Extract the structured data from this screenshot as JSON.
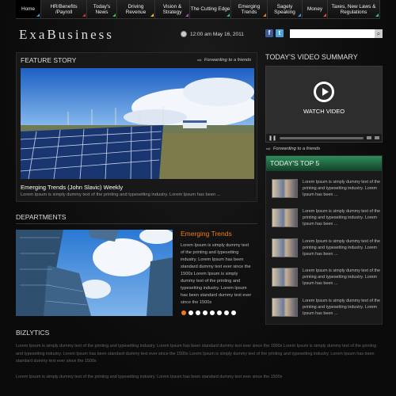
{
  "nav": [
    {
      "label": "Home",
      "color": "#2a9df4"
    },
    {
      "label": "HR/Benefits /Payroll",
      "color": "#e03030"
    },
    {
      "label": "Today's News",
      "color": "#2ecc40"
    },
    {
      "label": "Driving Revenue",
      "color": "#f1c40f"
    },
    {
      "label": "Vision & Strategy",
      "color": "#9b59b6"
    },
    {
      "label": "The Cutting Edge",
      "color": "#1abc9c"
    },
    {
      "label": "Emerging Trends",
      "color": "#e67e22"
    },
    {
      "label": "Sagely Speaking",
      "color": "#3498db"
    },
    {
      "label": "Money",
      "color": "#e74c3c"
    },
    {
      "label": "Taxes, New Laws & Regulations",
      "color": "#2ecc71"
    }
  ],
  "logo": "ExaBusiness",
  "clock": "12:00 am May 16, 2011",
  "social": {
    "facebook": "f",
    "twitter": "t"
  },
  "search": {
    "placeholder": ""
  },
  "feature": {
    "heading": "FEATURE STORY",
    "forward": "Forwarding to a friends",
    "title": "Emerging Trends (John Slavic)  Weekly",
    "desc": "Lorem Ipsum is simply dummy text of the printing and typesetting industry. Lorem Ipsum has been ..."
  },
  "video": {
    "heading": "TODAY'S VIDEO SUMMARY",
    "watch": "WATCH VIDEO",
    "forward": "Forwarding to a friends"
  },
  "top5": {
    "heading": "TODAY'S TOP 5",
    "items": [
      "Lorem Ipsum is simply dummy text of the printing and typesetting industry. Lorem Ipsum has been ...",
      "Lorem Ipsum is simply dummy text of the printing and typesetting industry. Lorem Ipsum has been ...",
      "Lorem Ipsum is simply dummy text of the printing and typesetting industry. Lorem Ipsum has been ...",
      "Lorem Ipsum is simply dummy text of the printing and typesetting industry. Lorem Ipsum has been ...",
      "Lorem Ipsum is simply dummy text of the printing and typesetting industry. Lorem Ipsum has been ..."
    ]
  },
  "departments": {
    "heading": "DEPARTMENTS",
    "title": "Emerging Trends",
    "text": "Lorem Ipsum is simply dummy text of the printing and typesetting industry. Lorem Ipsum has been standard dummy text ever since the 1500s Lorem Ipsum is simply dummy text of the printing and typesetting industry. Lorem Ipsum has been standard dummy text ever since the 1500s",
    "slides": 8,
    "active_slide": 1
  },
  "bizlytics": {
    "heading": "BIZLYTICS",
    "p1": "Lorem Ipsum is simply dummy text of the printing and typesetting industry. Lorem Ipsum has been standard dummy text ever since the 1500s Lorem Ipsum is simply dummy text of the printing and typesetting industry. Lorem Ipsum has been standard dummy text ever since the 1500s Lorem Ipsum is simply dummy text of the printing and typesetting industry. Lorem Ipsum has been standard dummy text ever since the 1500s",
    "p2": "Lorem Ipsum is simply dummy text of the printing and typesetting industry. Lorem Ipsum has been standard dummy text ever since the 1500s"
  }
}
